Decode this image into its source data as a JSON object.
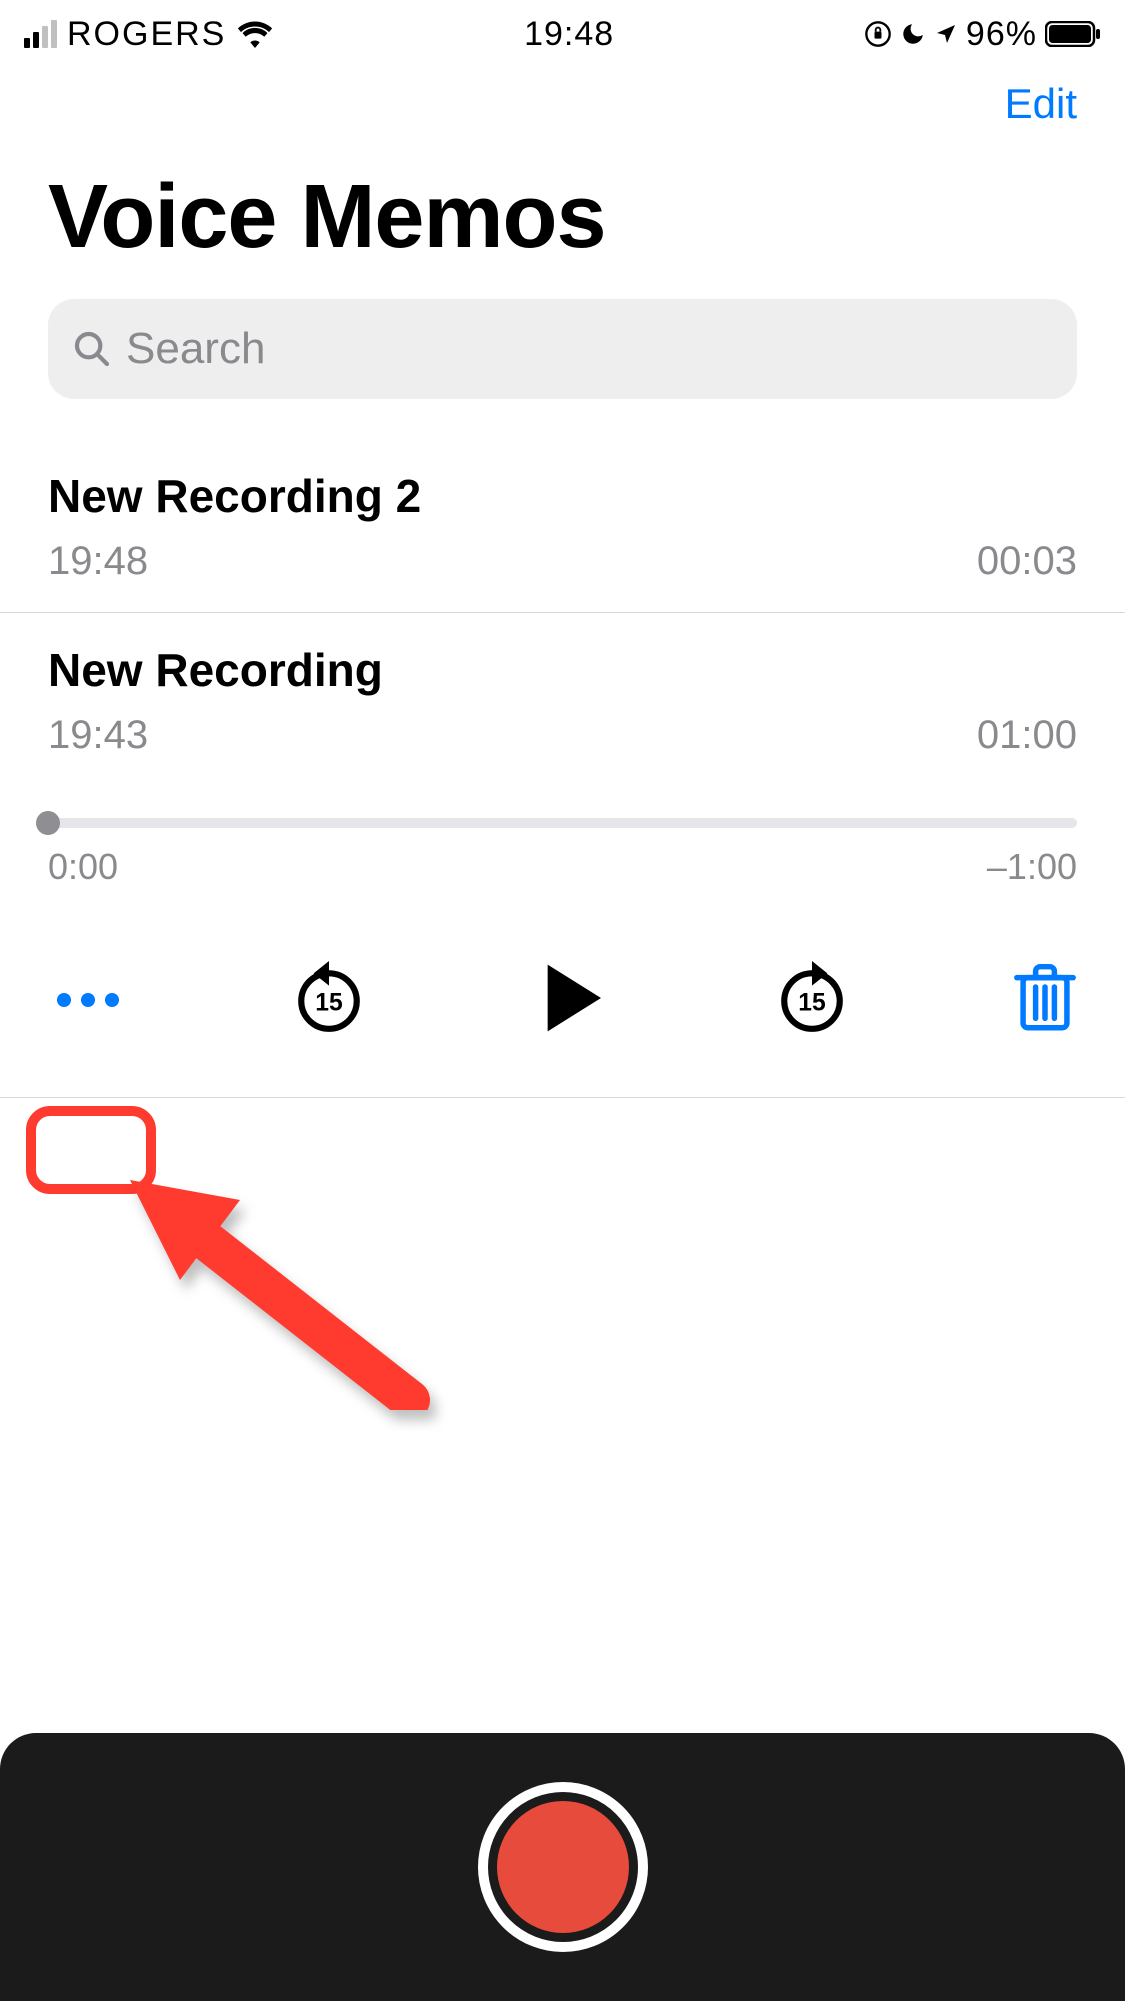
{
  "status": {
    "carrier": "ROGERS",
    "time": "19:48",
    "battery_pct": "96%"
  },
  "nav": {
    "edit": "Edit"
  },
  "header": {
    "title": "Voice Memos"
  },
  "search": {
    "placeholder": "Search"
  },
  "recordings": [
    {
      "title": "New Recording 2",
      "time": "19:48",
      "duration": "00:03"
    },
    {
      "title": "New Recording",
      "time": "19:43",
      "duration": "01:00"
    }
  ],
  "playback": {
    "elapsed": "0:00",
    "remaining": "–1:00",
    "skip_seconds": "15"
  },
  "icons": {
    "more": "more-options",
    "skip_back": "skip-back-15",
    "play": "play",
    "skip_fwd": "skip-forward-15",
    "trash": "trash",
    "record": "record"
  }
}
